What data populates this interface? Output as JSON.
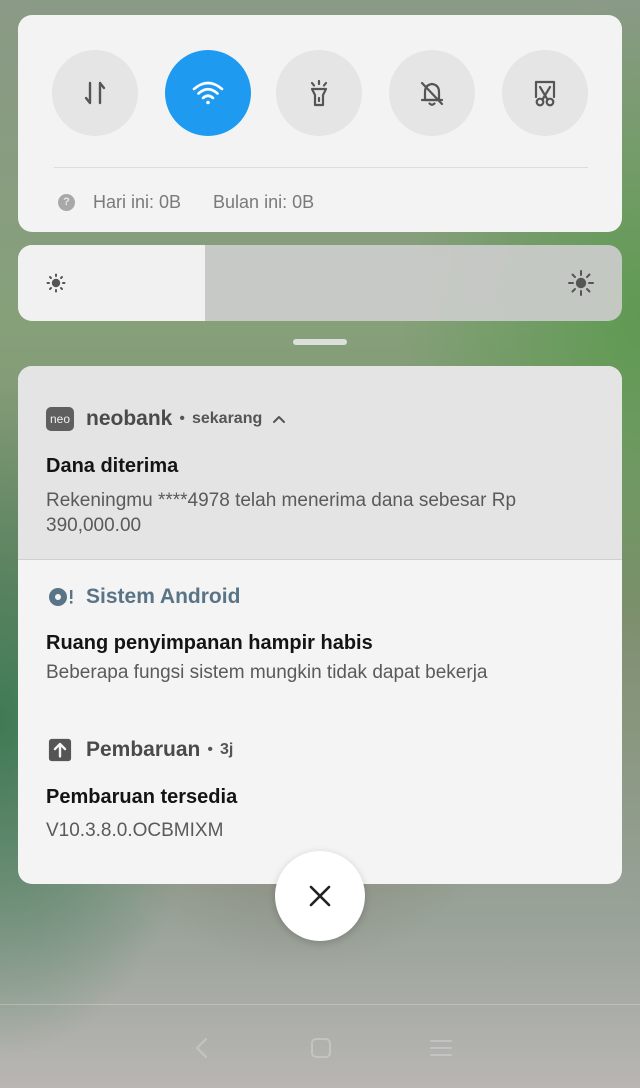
{
  "quick_settings": {
    "toggles": [
      {
        "name": "mobile-data",
        "active": false
      },
      {
        "name": "wifi",
        "active": true
      },
      {
        "name": "flashlight",
        "active": false
      },
      {
        "name": "mute",
        "active": false
      },
      {
        "name": "screenshot",
        "active": false
      }
    ],
    "data_usage": {
      "today": "Hari ini: 0B",
      "month": "Bulan ini: 0B"
    },
    "accent_color": "#1e9bf0"
  },
  "brightness": {
    "level": 0.31
  },
  "notifications": [
    {
      "app": "neobank",
      "icon_text": "neo",
      "separator": "•",
      "time": "sekarang",
      "title": "Dana diterima",
      "body": "Rekeningmu ****4978 telah menerima dana sebesar Rp 390,000.00"
    },
    {
      "app": "Sistem Android",
      "title": "Ruang penyimpanan hampir habis",
      "body": "Beberapa fungsi sistem mungkin tidak dapat bekerja"
    },
    {
      "app": "Pembaruan",
      "separator": "•",
      "time": "3j",
      "title": "Pembaruan tersedia",
      "body": "V10.3.8.0.OCBMIXM"
    }
  ]
}
